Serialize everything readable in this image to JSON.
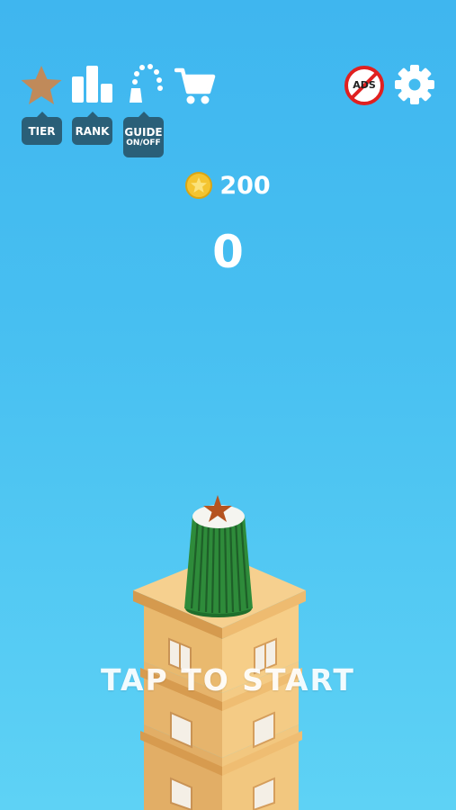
{
  "toolbar": {
    "tier_label": "TIER",
    "rank_label": "RANK",
    "guide_label": "GUIDE",
    "guide_sub_label": "ON/OFF",
    "no_ads_label": "ADS"
  },
  "hud": {
    "coins": "200",
    "score": "0"
  },
  "prompt": {
    "tap_to_start": "TAP TO START"
  },
  "colors": {
    "sky_top": "#3fb6ef",
    "sky_bottom": "#5ed2f5",
    "label_bg": "#2a5f78",
    "star_icon": "#c08a5a",
    "coin": "#f4c430",
    "no_ads_red": "#e02020",
    "building_wall": "#e9b96e",
    "cup_green": "#2e8b3a"
  },
  "icons": {
    "tier": "star-icon",
    "rank": "bar-chart-icon",
    "guide": "trajectory-icon",
    "shop": "cart-icon",
    "no_ads": "no-ads-icon",
    "settings": "gear-icon",
    "coin": "coin-icon"
  }
}
